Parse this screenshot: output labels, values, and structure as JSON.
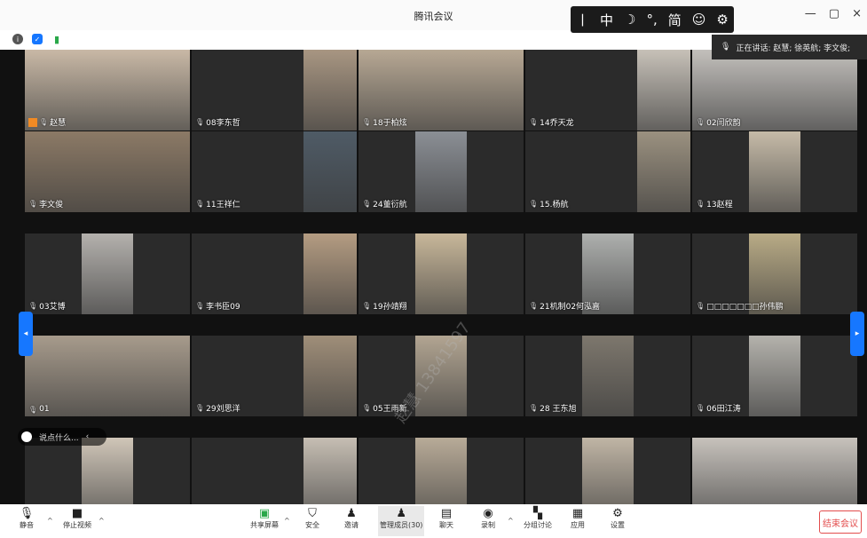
{
  "app": {
    "title": "腾讯会议",
    "min": "—",
    "restore": "▢",
    "close": "×"
  },
  "status_icons": [
    "info-icon",
    "shield-icon",
    "signal-icon"
  ],
  "ime": [
    "丨",
    "中",
    "☽",
    "°,",
    "简",
    "☺",
    "⚙"
  ],
  "speaking": {
    "label": "正在讲话: 赵慧; 徐英航; 李文俊;"
  },
  "watermark": "赵慧 13841597",
  "participants": [
    {
      "name": "赵慧",
      "row": 0,
      "col": 0,
      "video": "full",
      "color": "#c9b9a6"
    },
    {
      "name": "08李东哲",
      "row": 0,
      "col": 1,
      "video": "right",
      "color": "#a89682"
    },
    {
      "name": "18于柏炫",
      "row": 0,
      "col": 2,
      "video": "full",
      "color": "#b7a894"
    },
    {
      "name": "14乔天龙",
      "row": 0,
      "col": 3,
      "video": "right",
      "color": "#c7c1b8"
    },
    {
      "name": "02闫欣韵",
      "row": 0,
      "col": 4,
      "video": "full",
      "color": "#c3c0bc"
    },
    {
      "name": "李文俊",
      "row": 1,
      "col": 0,
      "video": "full",
      "color": "#8c7a66"
    },
    {
      "name": "11王祥仁",
      "row": 1,
      "col": 1,
      "video": "right",
      "color": "#4f5b66"
    },
    {
      "name": "24董衍航",
      "row": 1,
      "col": 2,
      "video": "center",
      "color": "#8b8f95"
    },
    {
      "name": "15.杨航",
      "row": 1,
      "col": 3,
      "video": "right",
      "color": "#9b9180"
    },
    {
      "name": "13赵程",
      "row": 1,
      "col": 4,
      "video": "center",
      "color": "#c6bba8"
    },
    {
      "name": "03艾博",
      "row": 2,
      "col": 0,
      "video": "center",
      "color": "#b4b1ad"
    },
    {
      "name": "李书臣09",
      "row": 2,
      "col": 1,
      "video": "right",
      "color": "#b49c82"
    },
    {
      "name": "19孙靖翔",
      "row": 2,
      "col": 2,
      "video": "center",
      "color": "#c8b79a"
    },
    {
      "name": "21机制02何泓嘉",
      "row": 2,
      "col": 3,
      "video": "center",
      "color": "#aeb0ae"
    },
    {
      "name": "□□□□□□□孙伟鹏",
      "row": 2,
      "col": 4,
      "video": "center",
      "color": "#b9ab86"
    },
    {
      "name": "01",
      "row": 3,
      "col": 0,
      "video": "full",
      "color": "#a79b8c"
    },
    {
      "name": "29刘思洋",
      "row": 3,
      "col": 1,
      "video": "right",
      "color": "#9f8e79"
    },
    {
      "name": "05王雨新",
      "row": 3,
      "col": 2,
      "video": "center",
      "color": "#b2a592"
    },
    {
      "name": "28 王东旭",
      "row": 3,
      "col": 3,
      "video": "center",
      "color": "#7d776d"
    },
    {
      "name": "06田江涛",
      "row": 3,
      "col": 4,
      "video": "center",
      "color": "#b4b2ac"
    },
    {
      "name": "",
      "row": 4,
      "col": 0,
      "video": "center",
      "color": "#d0c6b8"
    },
    {
      "name": "",
      "row": 4,
      "col": 1,
      "video": "right",
      "color": "#c6beb3"
    },
    {
      "name": "",
      "row": 4,
      "col": 2,
      "video": "center",
      "color": "#b8ab98"
    },
    {
      "name": "",
      "row": 4,
      "col": 3,
      "video": "center",
      "color": "#c0b5a5"
    },
    {
      "name": "",
      "row": 4,
      "col": 4,
      "video": "full",
      "color": "#c7c2bc"
    }
  ],
  "chat": {
    "placeholder": "说点什么...",
    "chevron": "‹"
  },
  "toolbar": {
    "mute": {
      "label": "静音",
      "icon": "mic-icon"
    },
    "video": {
      "label": "停止视频",
      "icon": "camera-icon"
    },
    "share": {
      "label": "共享屏幕",
      "icon": "screen-share-icon"
    },
    "security": {
      "label": "安全",
      "icon": "shield-icon"
    },
    "invite": {
      "label": "邀请",
      "icon": "add-user-icon"
    },
    "members": {
      "label": "管理成员(30)",
      "icon": "members-icon"
    },
    "chat": {
      "label": "聊天",
      "icon": "chat-icon"
    },
    "record": {
      "label": "录制",
      "icon": "record-icon"
    },
    "breakout": {
      "label": "分组讨论",
      "icon": "breakout-icon"
    },
    "apps": {
      "label": "应用",
      "icon": "apps-icon"
    },
    "settings": {
      "label": "设置",
      "icon": "gear-icon"
    },
    "end": {
      "label": "结束会议"
    }
  },
  "colors": {
    "accent": "#1677ff",
    "end": "#e34d4d",
    "self_badge": "#f08a24"
  }
}
